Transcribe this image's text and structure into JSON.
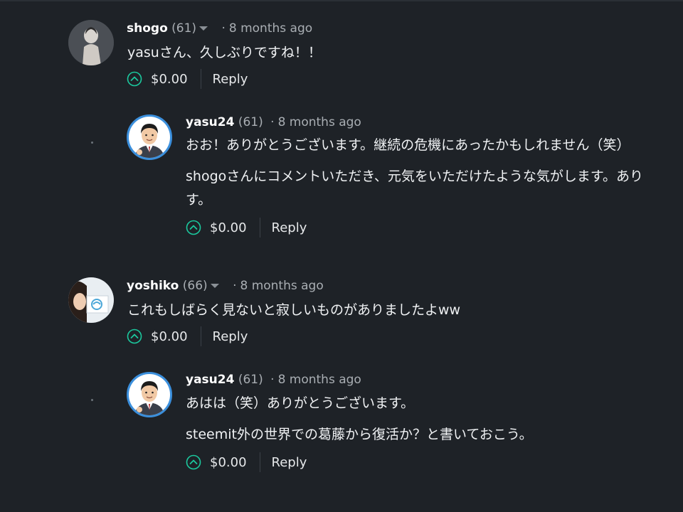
{
  "comments": [
    {
      "author": "shogo",
      "rep": "(61)",
      "time": "8 months ago",
      "lines": [
        "yasuさん、久しぶりですね！！"
      ],
      "payout": "$0.00",
      "reply_label": "Reply"
    },
    {
      "author": "yasu24",
      "rep": "(61)",
      "time": "8 months ago",
      "lines": [
        "おお！ありがとうございます。継続の危機にあったかもしれません（笑）",
        "shogoさんにコメントいただき、元気をいただけたような気がします。あり",
        "す。"
      ],
      "payout": "$0.00",
      "reply_label": "Reply"
    },
    {
      "author": "yoshiko",
      "rep": "(66)",
      "time": "8 months ago",
      "lines": [
        "これもしばらく見ないと寂しいものがありましたよww"
      ],
      "payout": "$0.00",
      "reply_label": "Reply"
    },
    {
      "author": "yasu24",
      "rep": "(61)",
      "time": "8 months ago",
      "lines": [
        "あはは（笑）ありがとうございます。",
        "steemit外の世界での葛藤から復活か？と書いておこう。"
      ],
      "payout": "$0.00",
      "reply_label": "Reply"
    }
  ],
  "dot_separator": "·",
  "colors": {
    "accent": "#1bc99e",
    "avatar_ring": "#3b8fdc",
    "background": "#1e2227"
  },
  "icons": {
    "upvote": "chevron-up-circle-icon",
    "dropdown": "caret-down-icon"
  }
}
